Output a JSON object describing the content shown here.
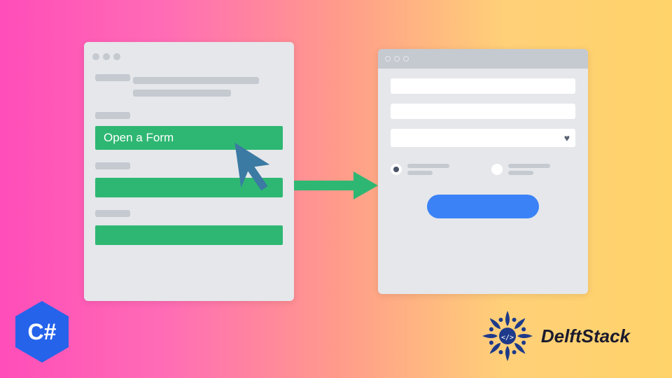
{
  "left_window": {
    "button_label": "Open a Form"
  },
  "badges": {
    "csharp": "C#"
  },
  "brand": {
    "name": "DelftStack"
  },
  "colors": {
    "green": "#2eb772",
    "blue": "#3b82f6",
    "cursor": "#3b7aa3"
  }
}
